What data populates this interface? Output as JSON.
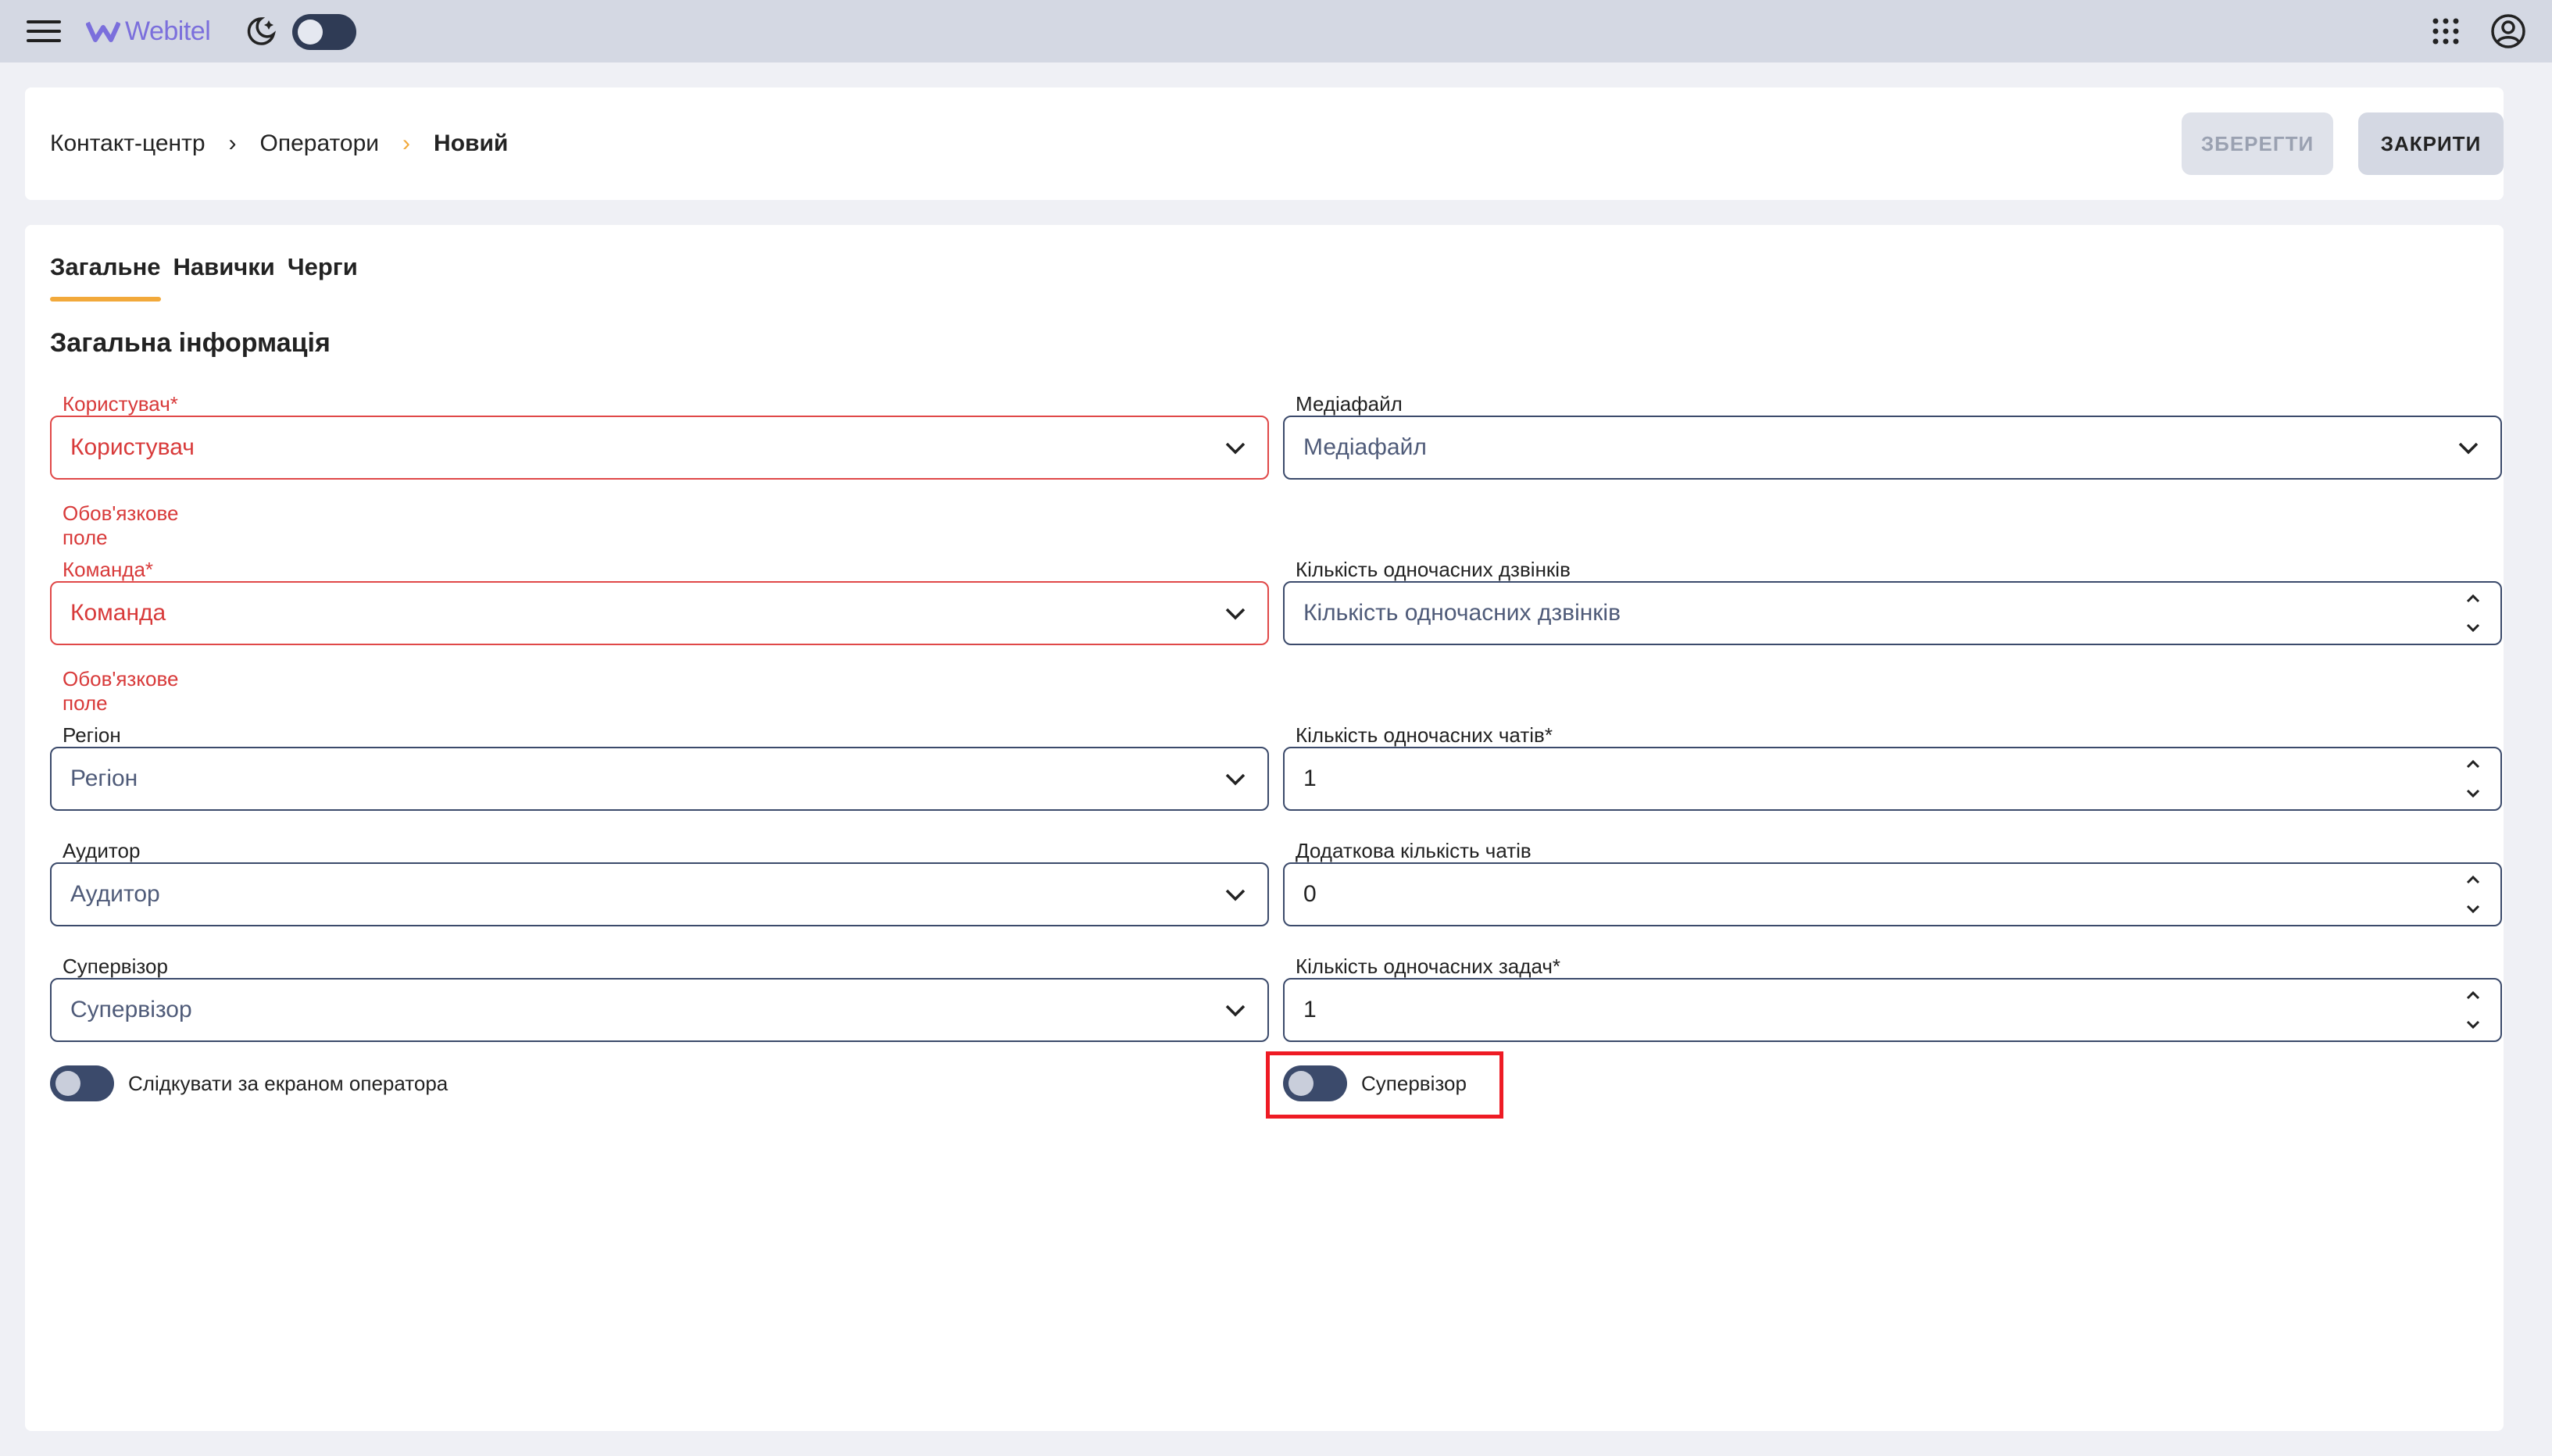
{
  "app": {
    "logo_text": "Webitel"
  },
  "header": {
    "breadcrumb": [
      "Контакт-центр",
      "Оператори",
      "Новий"
    ],
    "save_label": "ЗБЕРЕГТИ",
    "close_label": "ЗАКРИТИ"
  },
  "tabs": [
    "Загальне",
    "Навички",
    "Черги"
  ],
  "section_title": "Загальна інформація",
  "left_fields": {
    "user": {
      "label": "Користувач*",
      "placeholder": "Користувач",
      "error": "Обов'язкове поле"
    },
    "team": {
      "label": "Команда*",
      "placeholder": "Команда",
      "error": "Обов'язкове поле"
    },
    "region": {
      "label": "Регіон",
      "placeholder": "Регіон"
    },
    "auditor": {
      "label": "Аудитор",
      "placeholder": "Аудитор"
    },
    "supervisor": {
      "label": "Супервізор",
      "placeholder": "Супервізор"
    }
  },
  "right_fields": {
    "media": {
      "label": "Медіафайл",
      "placeholder": "Медіафайл"
    },
    "calls": {
      "label": "Кількість одночасних дзвінків",
      "placeholder": "Кількість одночасних дзвінків"
    },
    "chats": {
      "label": "Кількість одночасних чатів*",
      "value": "1"
    },
    "extra_chats": {
      "label": "Додаткова кількість чатів",
      "value": "0"
    },
    "tasks": {
      "label": "Кількість одночасних задач*",
      "value": "1"
    }
  },
  "toggles": {
    "screen_follow": {
      "label": "Слідкувати за екраном оператора",
      "on": false
    },
    "is_supervisor": {
      "label": "Супервізор",
      "on": false
    }
  },
  "colors": {
    "accent": "#f2a93b",
    "error": "#d83a3a",
    "highlight": "#ee1b24",
    "brand": "#7b6fdc"
  }
}
